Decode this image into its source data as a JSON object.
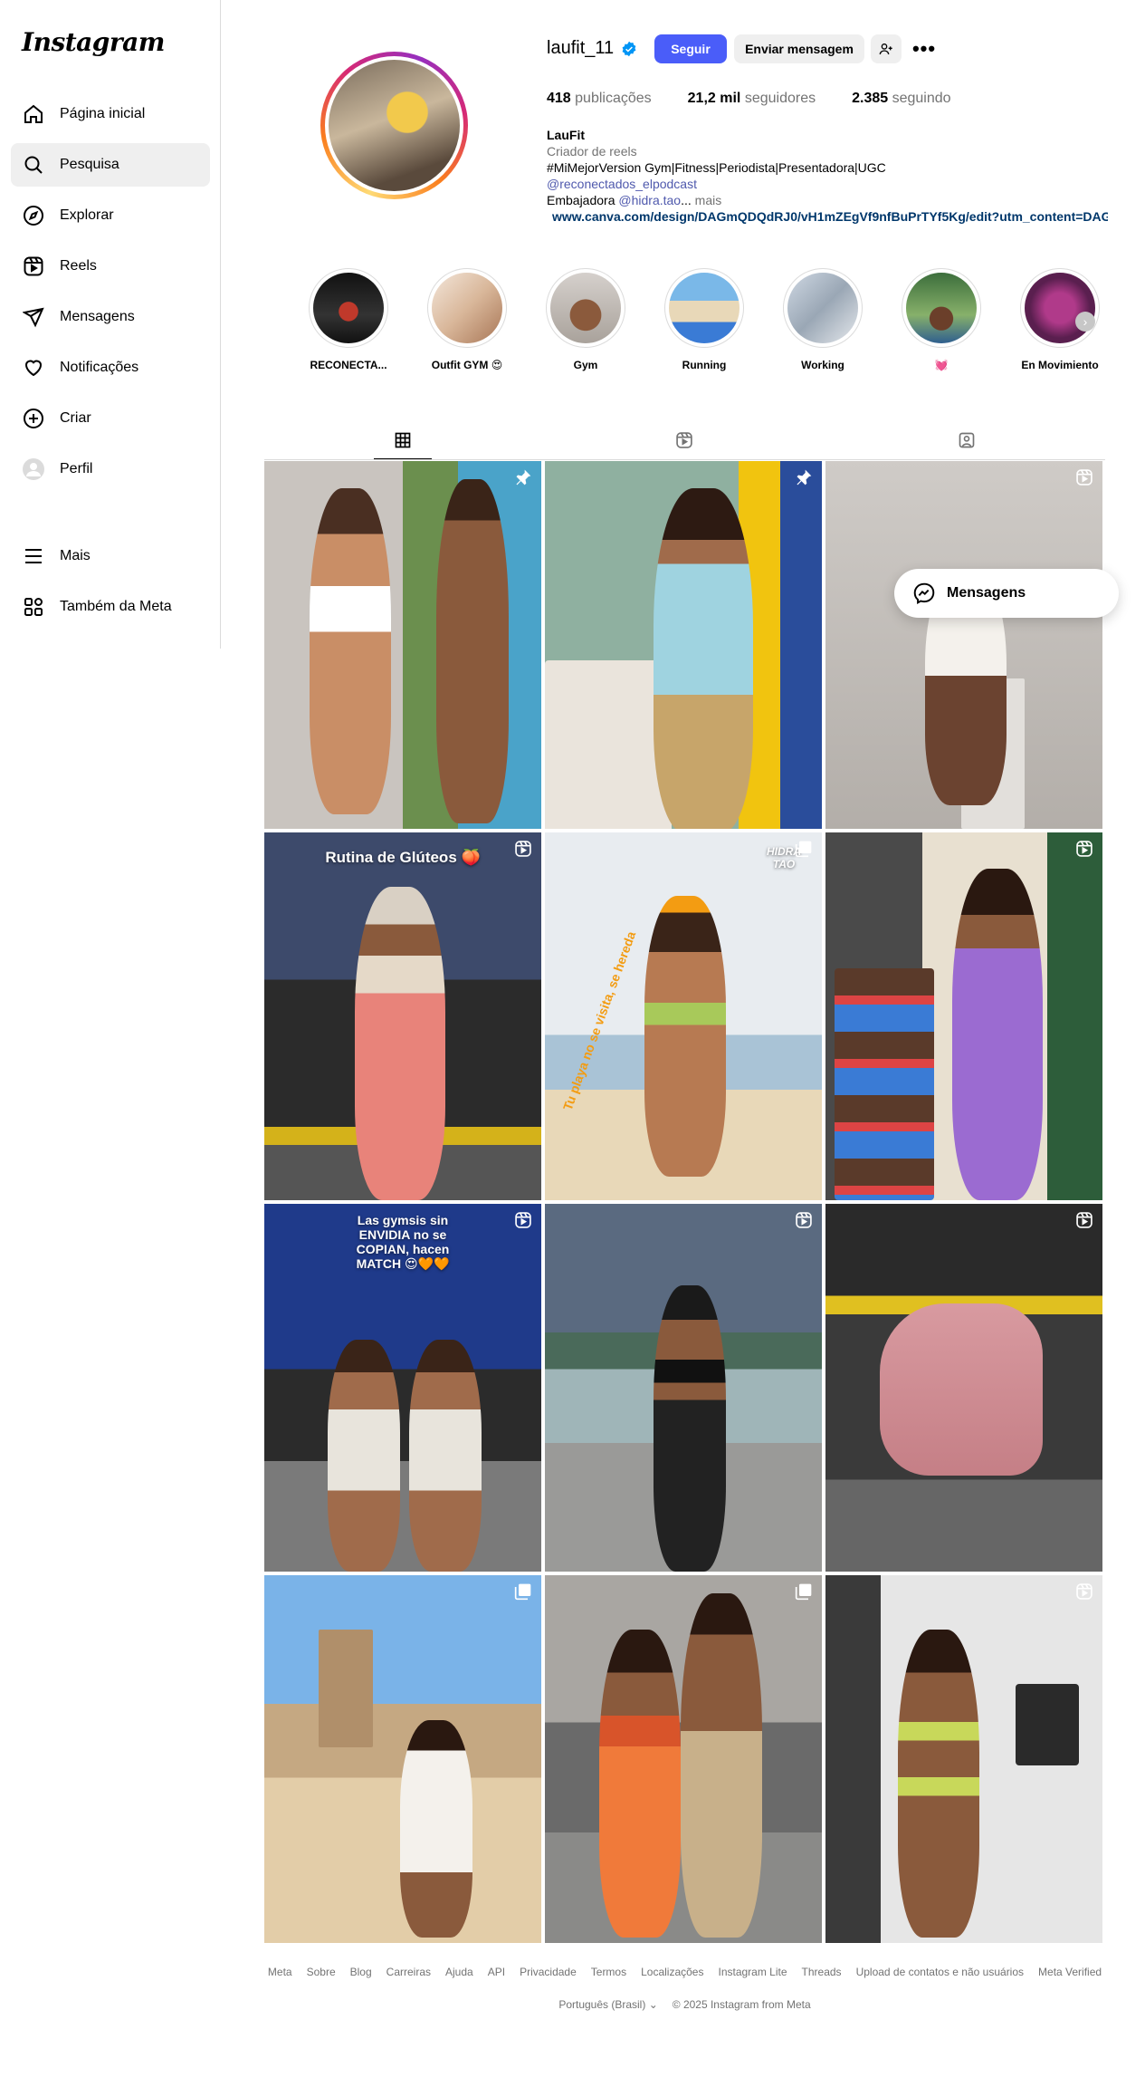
{
  "brand": "Instagram",
  "nav": {
    "items": [
      {
        "label": "Página inicial",
        "icon": "home-icon"
      },
      {
        "label": "Pesquisa",
        "icon": "search-icon"
      },
      {
        "label": "Explorar",
        "icon": "compass-icon"
      },
      {
        "label": "Reels",
        "icon": "reels-icon"
      },
      {
        "label": "Mensagens",
        "icon": "send-icon"
      },
      {
        "label": "Notificações",
        "icon": "heart-icon"
      },
      {
        "label": "Criar",
        "icon": "plus-square-icon"
      },
      {
        "label": "Perfil",
        "icon": "profile-avatar-icon"
      }
    ],
    "bottom": [
      {
        "label": "Mais",
        "icon": "menu-icon"
      },
      {
        "label": "Também da Meta",
        "icon": "meta-apps-icon"
      }
    ],
    "active_index": 1
  },
  "profile": {
    "username": "laufit_11",
    "verified": true,
    "follow_label": "Seguir",
    "message_label": "Enviar mensagem",
    "more_label": "•••",
    "stats": {
      "posts_count": "418",
      "posts_label": "publicações",
      "followers_count": "21,2 mil",
      "followers_label": "seguidores",
      "following_count": "2.385",
      "following_label": "seguindo"
    },
    "bio": {
      "name": "LauFit",
      "category": "Criador de reels",
      "line1": "#MiMejorVersion Gym|Fitness|Periodista|Presentadora|UGC",
      "mention_link": "@reconectados_elpodcast",
      "ambassador_prefix": "Embajadora ",
      "ambassador_mention": "@hidra.tao",
      "ellipsis": "...",
      "more": " mais",
      "url": "www.canva.com/design/DAGmQDQdRJ0/vH1mZEgVf9nfBuPrTYf5Kg/edit?utm_content=DAGmQ"
    }
  },
  "highlights": [
    {
      "label": "RECONECTA..."
    },
    {
      "label": "Outfit GYM 😍"
    },
    {
      "label": "Gym"
    },
    {
      "label": "Running"
    },
    {
      "label": "Working"
    },
    {
      "label": "💓"
    },
    {
      "label": "En Movimiento"
    }
  ],
  "tabs": [
    "posts-grid",
    "reels",
    "tagged"
  ],
  "posts": [
    {
      "overlay": "",
      "badge": "pin-icon"
    },
    {
      "overlay": "",
      "badge": "pin-icon"
    },
    {
      "overlay": "",
      "badge": "reel-icon"
    },
    {
      "overlay": "Rutina de Glúteos 🍑",
      "badge": "reel-icon"
    },
    {
      "overlay": "Tu playa no se visita, se hereda",
      "brand": "HIDRA TAO",
      "badge": "carousel-icon"
    },
    {
      "overlay": "",
      "badge": "reel-icon"
    },
    {
      "overlay": "Las gymsis sin ENVIDIA no se COPIAN, hacen MATCH 😍🧡🧡",
      "badge": "reel-icon"
    },
    {
      "overlay": "",
      "badge": "reel-icon"
    },
    {
      "overlay": "",
      "badge": "reel-icon"
    },
    {
      "overlay": "",
      "badge": "carousel-icon"
    },
    {
      "overlay": "",
      "badge": "carousel-icon"
    },
    {
      "overlay": "",
      "badge": "reel-icon"
    }
  ],
  "floating": {
    "label": "Mensagens"
  },
  "footer": {
    "links": [
      "Meta",
      "Sobre",
      "Blog",
      "Carreiras",
      "Ajuda",
      "API",
      "Privacidade",
      "Termos",
      "Localizações",
      "Instagram Lite",
      "Threads",
      "Upload de contatos e não usuários",
      "Meta Verified"
    ],
    "language": "Português (Brasil)",
    "copyright": "© 2025 Instagram from Meta"
  },
  "colors": {
    "accent": "#4a5df9",
    "link": "#00376b",
    "muted": "#737373",
    "border": "#dbdbdb"
  }
}
